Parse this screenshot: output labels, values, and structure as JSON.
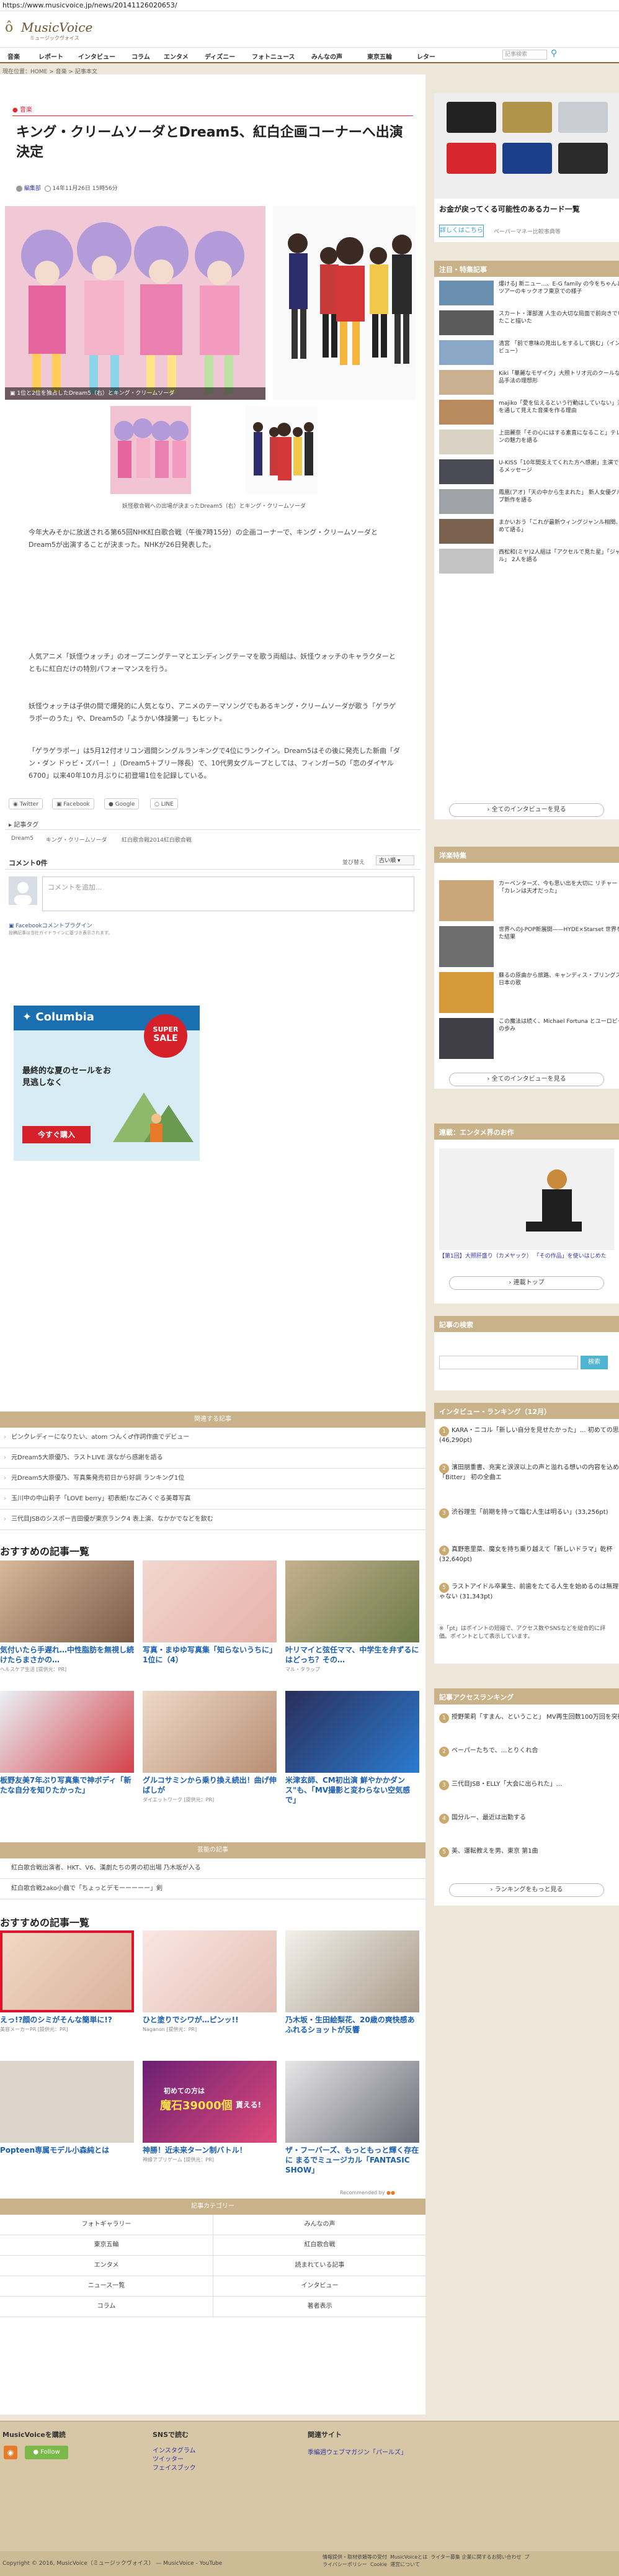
{
  "browser": {
    "url": "https://www.musicvoice.jp/news/20141126020653/"
  },
  "header": {
    "logo_mark": "ô",
    "logo": "MusicVoice",
    "logo_sub": "ミュージックヴォイス"
  },
  "nav": {
    "items": [
      "音楽",
      "レポート",
      "インタビュー",
      "コラム",
      "エンタメ",
      "ディズニー",
      "フォトニュース",
      "みんなの声",
      "東京五輪",
      "レター"
    ],
    "search_placeholder": "記事検索"
  },
  "breadcrumb": "現在位置：HOME > 音楽 > 記事本文",
  "article": {
    "category": "音楽",
    "title": "キング・クリームソーダとDream5、紅白企画コーナーへ出演決定",
    "author": "編集部",
    "date": "14年11月26日 15時56分",
    "main_caption": "1位と2位を独占したDream5（右）とキング・クリームソーダ",
    "sub_caption": "妖怪歌合戦への出場が決まったDream5（右）とキング・クリームソーダ",
    "paragraphs": [
      "今年大みそかに放送される第65回NHK紅白歌合戦（午後7時15分）の企画コーナーで、キング・クリームソーダとDream5が出演することが決まった。NHKが26日発表した。",
      "人気アニメ「妖怪ウォッチ」のオープニングテーマとエンディングテーマを歌う両組は、妖怪ウォッチのキャラクターとともに紅白だけの特別パフォーマンスを行う。",
      "妖怪ウォッチは子供の間で爆発的に人気となり、アニメのテーマソングでもあるキング・クリームソーダが歌う「ゲラゲラポーのうた」や、Dream5の「ようかい体操第一」もヒット。",
      "「ゲラゲラポー」は5月12付オリコン週間シングルランキングで4位にランクイン。Dream5はその後に発売した新曲「ダン・ダン ドゥビ・ズバー！」（Dream5＋ブリー隊長）で、10代男女グループとしては、フィンガー5の「恋のダイヤル6700」以来40年10カ月ぶりに初登場1位を記録している。"
    ]
  },
  "share": {
    "twitter": "Twitter",
    "facebook": "Facebook",
    "google": "Google",
    "line": "LINE"
  },
  "tags": {
    "label": "記事タグ",
    "items": [
      "Dream5",
      "キング・クリームソーダ",
      "紅白歌合戦2014紅白歌合戦"
    ]
  },
  "comments": {
    "label": "コメント0件",
    "sort_label": "並び替え",
    "sort_value": "古い順",
    "placeholder": "コメントを追加...",
    "plugin": "Facebookコメントプラグイン",
    "note": "投稿記事は当社ガイドラインに基づき表示されます。"
  },
  "ad": {
    "brand": "Columbia",
    "badge_top": "SUPER",
    "badge_bottom": "SALE",
    "text": "最終的な夏のセールをお見逃しなく",
    "cta": "今すぐ購入"
  },
  "related": {
    "title": "関連する記事",
    "items": [
      "ピンクレディーになりたい、atom つんく♂作詞作曲でデビュー",
      "元Dream5大原優乃、ラストLIVE 涙ながら感謝を語る",
      "元Dream5大原優乃、写真集発売初日から好調 ランキング1位",
      "玉川中の中山莉子「LOVE berry」初表紙!なごみくぐる美尊写真",
      "三代目JSBのシスポー吉田優が東京ランク4 表上演、なかかでなどを飲む"
    ]
  },
  "recommend1": {
    "title": "おすすめの記事一覧",
    "cards": [
      {
        "text": "気付いたら手遅れ…中性脂肪を無視し続けたらまさかの…",
        "src": "ヘルスケア生活 [提供元：PR]"
      },
      {
        "text": "写真・まゆゆ写真集「知らないうちに」1位に（4）",
        "src": ""
      },
      {
        "text": "叶リマイと弦任ママ、中学生を弁ずるにはどっち？その…",
        "src": "マル・タラップ"
      },
      {
        "text": "板野友美7年ぶり写真集で神ボディ「新たな自分を知りたかった」",
        "src": ""
      },
      {
        "text": "グルコサミンから乗り換え続出！曲げ伸ばしが",
        "src": "ダイエットワーク [提供元：PR]"
      },
      {
        "text": "米津玄師、CM初出演 鮮やかかダンス\"も、「MV撮影と変わらない空気感で」",
        "src": ""
      }
    ]
  },
  "events": {
    "title": "芸能の記事",
    "items": [
      "紅白歌合戦出演者、HKT、V6、漢劇たちの男の初出場 乃木坂が入る",
      "紅白歌合戦2ako小曲で「ちょっとデモーーーーー」剣"
    ]
  },
  "recommend2": {
    "title": "おすすめの記事一覧",
    "cards": [
      {
        "text": "えっ!?顔のシミがそんな簡単に!?",
        "src": "美容メーカーPR [提供元：PR]"
      },
      {
        "text": "ひと塗りでシワが…ピンッ!!",
        "src": "Naganon [提供元：PR]"
      },
      {
        "text": "乃木坂・生田絵梨花、20歳の爽快感あふれるショットが反響",
        "src": ""
      },
      {
        "text": "Popteen専属モデル小森純とは",
        "src": ""
      },
      {
        "text": "神勝！近未来ターン制バトル！",
        "src": "神縁アプリゲーム [提供元：PR]"
      },
      {
        "text": "ザ・フーバーズ、もっともっと輝く存在に まるでミュージカル「FANTASIC SHOW」",
        "src": ""
      }
    ],
    "card5_overlay_top": "初めての方は",
    "card5_overlay_main": "魔石39000個",
    "card5_overlay_tail": "貰える!",
    "powered": "Recommended by"
  },
  "categories": {
    "title": "記事カテゴリー",
    "left": [
      "フォトギャラリー",
      "東京五輪",
      "エンタメ",
      "ニュース一覧",
      "コラム"
    ],
    "right": [
      "みんなの声",
      "紅白歌合戦",
      "読まれている記事",
      "インタビュー",
      "著者表示"
    ]
  },
  "footer": {
    "col1_title": "MusicVoiceを購読",
    "follow": "Follow",
    "col2_title": "SNSで読む",
    "col2_links": [
      "インスタグラム",
      "ツイッター",
      "フェイスブック"
    ],
    "col3_title": "関連サイト",
    "col3_links": [
      "季編週ウェブマガジン「パールズ」"
    ],
    "copyright": "Copyright © 2016, MusicVoice（ミュージックヴォイス） — MusicVoice - YouTube",
    "bottom_links": [
      "情報提供・取材依頼等の受付",
      "MusicVoiceとは",
      "ライター募集",
      "企業に関するお問い合わせ",
      "プライバシーポリシー",
      "Cookie",
      "運営について"
    ]
  },
  "sidebar": {
    "ad_title": "お金が戻ってくる可能性のあるカード一覧",
    "ad_more": "詳しくはこちら",
    "ad_src": "ペーパーマネー比較事典等",
    "interview_title": "注目・特集記事",
    "interviews": [
      "爆けるJ 新ニュー…、E-G family の今をちゃんと…ツアーのキックオフ東京での様子",
      "スカート・澤部渡 人生の大切な局面で前向きでいれたこと描いた",
      "清宮 「前で意味の見出しをするして挑む」（インタビュー）",
      "Kiki「華麗なモザイク」大照トリオ元のクールな作品手法の理想形",
      "majiko「愛を伝えるという行動はしていない」活動を通して見えた音楽を作る理由",
      "上田麗奈「その心にはする素直になること」テレホンの魅力を語る",
      "U-KISS「10年間支えてくれた方へ感謝」主演で語るメッセージ",
      "鳳凰(アオ)「天の中から生まれた」 新人女優グループ新作を語る",
      "まかいおう「これが最新ウィングジャンル相関、改めて語る」",
      "西松和(ミヤ)2人組は「アクセルで見た星」「ジャンル」 2人を語る"
    ],
    "interview_more": "全てのインタビューを見る",
    "drama_title": "洋楽特集",
    "dramas": [
      "カーペンターズ、今も思い出を大切に リチャード「カレンは天才だった」",
      "世界へのJ-POP新展開——HYDE×Starset 世界を見た結果",
      "蘇るの原曲から旅路、キャンディス・プリングス、日本の歌",
      "この魔法は続く、Michael Fortuna とユーロビートの歩み"
    ],
    "drama_more": "全てのインタビューを見る",
    "serial_title": "連載：エンタメ界のお作",
    "serial_caption": "【第1回】大照肝盛り（カメヤック） 「その作品」を使いはじめた",
    "serial_more": "連載トップ",
    "search_title": "記事の検索",
    "search_btn": "検索",
    "ranking_title": "インタビュー・ランキング（12月）",
    "ranking": [
      "KARA・ニコル「新しい自分を見せたかった」… 初めての思い (46,290pt)",
      "濱田朋重書、充実と涙涙以上の声と溢れる想いの内容を込めた 「Bitter」 初の全曲エ",
      "渋谷理生「前期を持って臨む人生は明るい」(33,256pt)",
      "真野恵里菜、魔女を持ち乗り越えて「新しいドラマ」乾杯(32,640pt)",
      "ラストアイドル卒業生、前歯をたてる人生を始めるのは無理じゃない (31,343pt)"
    ],
    "ranking_note": "※「pt」はポイントの短縮で、アクセス数やSNSなどを総合的に評価。ポイントとして表示しています。",
    "access_title": "記事アクセスランキング",
    "access": [
      "授野茉莉「すまん、ということ」 MV再生回数100万回を突破",
      "ペーパーたちで、…とりくれ合",
      "三代目JSB・ELLY「大会に出られた」…",
      "国分ルー、最近は出勤する",
      "美、運転教えを男、東京 第1曲"
    ],
    "access_more": "ランキングをもっと見る"
  }
}
